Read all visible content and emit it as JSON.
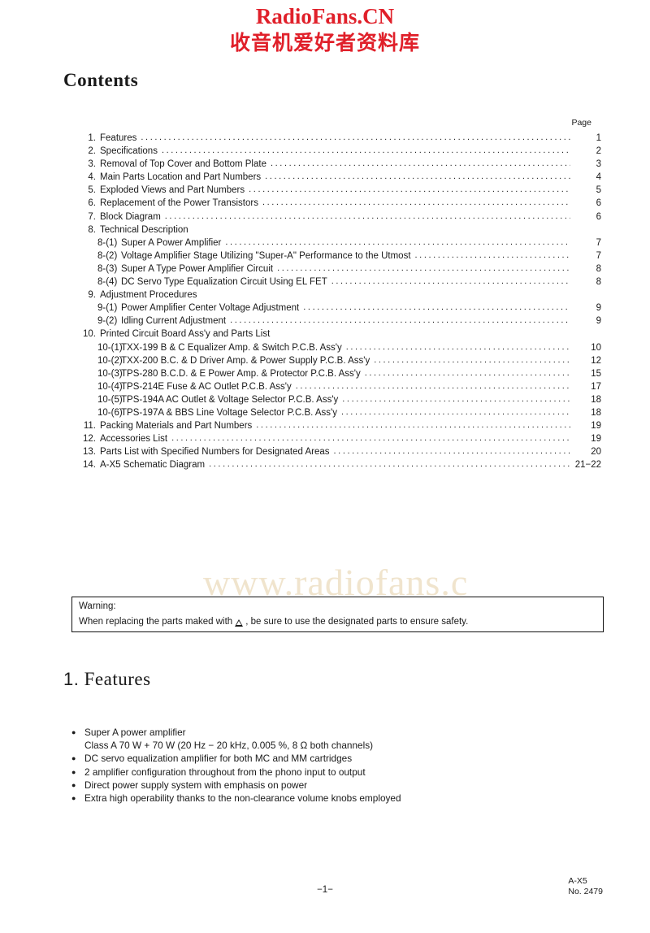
{
  "watermark": {
    "title": "RadioFans.CN",
    "subtitle": "收音机爱好者资料库",
    "diagonal": "www.radiofans.c"
  },
  "contents": {
    "heading": "Contents",
    "page_column_label": "Page",
    "dots": "...........................................................................................................................................................",
    "rows": [
      {
        "num": "1.",
        "label": "Features",
        "page": "1",
        "sub": false
      },
      {
        "num": "2.",
        "label": "Specifications",
        "page": "2",
        "sub": false
      },
      {
        "num": "3.",
        "label": "Removal of Top Cover and Bottom Plate",
        "page": "3",
        "sub": false
      },
      {
        "num": "4.",
        "label": "Main Parts Location and Part Numbers",
        "page": "4",
        "sub": false
      },
      {
        "num": "5.",
        "label": "Exploded Views and Part Numbers",
        "page": "5",
        "sub": false
      },
      {
        "num": "6.",
        "label": "Replacement of the Power Transistors",
        "page": "6",
        "sub": false
      },
      {
        "num": "7.",
        "label": "Block Diagram",
        "page": "6",
        "sub": false
      },
      {
        "num": "8.",
        "label": "Technical Description",
        "page": "",
        "sub": false,
        "nodots": true
      },
      {
        "num": "8-(1)",
        "label": "Super A Power Amplifier",
        "page": "7",
        "sub": true
      },
      {
        "num": "8-(2)",
        "label": "Voltage Amplifier Stage Utilizing \"Super-A\" Performance to the Utmost",
        "page": "7",
        "sub": true
      },
      {
        "num": "8-(3)",
        "label": "Super A Type Power Amplifier Circuit",
        "page": "8",
        "sub": true
      },
      {
        "num": "8-(4)",
        "label": "DC Servo Type Equalization Circuit Using EL FET",
        "page": "8",
        "sub": true
      },
      {
        "num": "9.",
        "label": "Adjustment Procedures",
        "page": "",
        "sub": false,
        "nodots": true
      },
      {
        "num": "9-(1)",
        "label": "Power Amplifier Center Voltage Adjustment",
        "page": "9",
        "sub": true
      },
      {
        "num": "9-(2)",
        "label": "Idling Current Adjustment",
        "page": "9",
        "sub": true
      },
      {
        "num": "10.",
        "label": "Printed Circuit Board Ass'y and Parts List",
        "page": "",
        "sub": false,
        "nodots": true
      },
      {
        "num": "10-(1)",
        "label": "TXX-199 B & C Equalizer Amp. & Switch P.C.B. Ass'y",
        "page": "10",
        "sub": true
      },
      {
        "num": "10-(2)",
        "label": "TXX-200 B.C. & D Driver Amp. & Power Supply P.C.B. Ass'y",
        "page": "12",
        "sub": true
      },
      {
        "num": "10-(3)",
        "label": "TPS-280 B.C.D. & E Power Amp. & Protector P.C.B. Ass'y",
        "page": "15",
        "sub": true
      },
      {
        "num": "10-(4)",
        "label": "TPS-214E Fuse & AC Outlet P.C.B. Ass'y",
        "page": "17",
        "sub": true
      },
      {
        "num": "10-(5)",
        "label": "TPS-194A AC Outlet & Voltage Selector P.C.B. Ass'y",
        "page": "18",
        "sub": true
      },
      {
        "num": "10-(6)",
        "label": "TPS-197A & BBS Line Voltage Selector P.C.B. Ass'y",
        "page": "18",
        "sub": true
      },
      {
        "num": "11.",
        "label": "Packing Materials and Part Numbers",
        "page": "19",
        "sub": false
      },
      {
        "num": "12.",
        "label": "Accessories List",
        "page": "19",
        "sub": false
      },
      {
        "num": "13.",
        "label": "Parts List with Specified Numbers for Designated Areas",
        "page": "20",
        "sub": false
      },
      {
        "num": "14.",
        "label": "A-X5 Schematic Diagram",
        "page": "21−22",
        "sub": false
      }
    ]
  },
  "warning": {
    "title": "Warning:",
    "text_before": "When replacing the parts maked with",
    "text_after": ", be sure to use the designated parts to ensure safety."
  },
  "features": {
    "section_number": "1.",
    "heading": "Features",
    "items": [
      {
        "text": "Super A power amplifier",
        "sub": "Class A 70 W + 70 W (20 Hz − 20 kHz, 0.005 %, 8 Ω both channels)"
      },
      {
        "text": "DC servo equalization amplifier for both MC and MM cartridges",
        "sub": ""
      },
      {
        "text": "2 amplifier configuration throughout from the phono input to output",
        "sub": ""
      },
      {
        "text": "Direct power supply system with emphasis on power",
        "sub": ""
      },
      {
        "text": "Extra high operability thanks to the non-clearance volume knobs employed",
        "sub": ""
      }
    ]
  },
  "footer": {
    "page_number": "−1−",
    "model": "A-X5",
    "doc_number": "No. 2479"
  }
}
